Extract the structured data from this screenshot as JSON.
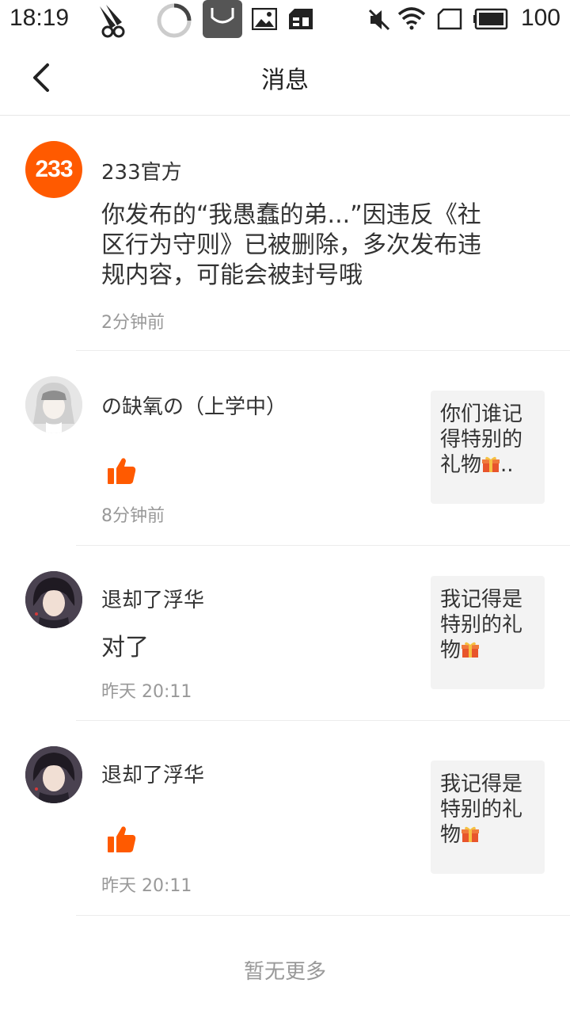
{
  "status_bar": {
    "time": "18:19",
    "battery": "100",
    "icons": [
      "app-logo-icon",
      "loading-circle-icon",
      "store-bag-icon",
      "image-icon",
      "sim-card-icon",
      "mute-icon",
      "wifi-icon",
      "sim-slot-icon",
      "battery-icon"
    ]
  },
  "header": {
    "title": "消息",
    "back_icon": "chevron-left-icon"
  },
  "messages": [
    {
      "sender": "233官方",
      "avatar_text": "233",
      "avatar_color": "#ff5a00",
      "text_line1": "你发布的“我愚蠢的弟...”因违反《社",
      "text_line2": "区行为守则》已被删除，多次发布违",
      "text_line3": "规内容，可能会被封号哦",
      "time": "2分钟前"
    },
    {
      "sender": "の缺氧の（上学中）",
      "action_icon": "thumbs-up-icon",
      "time": "8分钟前",
      "quote_line1": "你们谁记",
      "quote_line2": "得特别的",
      "quote_line3": "礼物",
      "quote_suffix": ".."
    },
    {
      "sender": "退却了浮华",
      "text": "对了",
      "time": "昨天 20:11",
      "quote_line1": "我记得是",
      "quote_line2": "特别的礼",
      "quote_line3": "物"
    },
    {
      "sender": "退却了浮华",
      "action_icon": "thumbs-up-icon",
      "time": "昨天 20:11",
      "quote_line1": "我记得是",
      "quote_line2": "特别的礼",
      "quote_line3": "物"
    }
  ],
  "footer": {
    "no_more": "暂无更多"
  },
  "colors": {
    "accent": "#ff5a00",
    "divider": "#ececec",
    "quote_bg": "#f3f3f3"
  }
}
